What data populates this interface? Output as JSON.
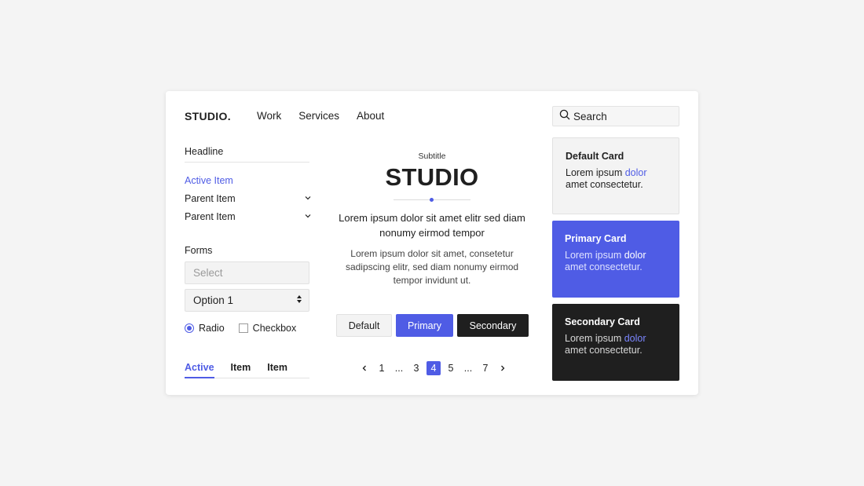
{
  "header": {
    "logo": "STUDIO.",
    "nav": [
      "Work",
      "Services",
      "About"
    ],
    "search_placeholder": "Search"
  },
  "sidebar": {
    "headline": "Headline",
    "items": [
      {
        "label": "Active Item",
        "active": true
      },
      {
        "label": "Parent Item",
        "active": false
      },
      {
        "label": "Parent Item",
        "active": false
      }
    ],
    "forms_label": "Forms",
    "select_placeholder": "Select",
    "option_value": "Option 1",
    "radio_label": "Radio",
    "checkbox_label": "Checkbox",
    "tabs": [
      "Active",
      "Item",
      "Item"
    ]
  },
  "hero": {
    "subtitle": "Subtitle",
    "title": "STUDIO",
    "lead": "Lorem ipsum dolor sit amet elitr sed diam nonumy eirmod tempor",
    "body": "Lorem ipsum dolor sit amet, consetetur sadipscing elitr, sed diam nonumy eirmod tempor invidunt ut.",
    "buttons": {
      "default": "Default",
      "primary": "Primary",
      "secondary": "Secondary"
    },
    "pagination": [
      "1",
      "...",
      "3",
      "4",
      "5",
      "...",
      "7"
    ],
    "active_page": "4"
  },
  "cards": [
    {
      "title": "Default Card",
      "text_before": "Lorem ipsum ",
      "text_accent": "dolor",
      "text_after": "amet consectetur."
    },
    {
      "title": "Primary Card",
      "text_before": "Lorem ipsum ",
      "text_accent": "dolor",
      "text_after": "amet consectetur."
    },
    {
      "title": "Secondary Card",
      "text_before": "Lorem ipsum ",
      "text_accent": "dolor",
      "text_after": "amet consectetur."
    }
  ],
  "colors": {
    "accent": "#4f5ce5",
    "dark": "#1f1f1f",
    "background": "#f4f4f4"
  }
}
